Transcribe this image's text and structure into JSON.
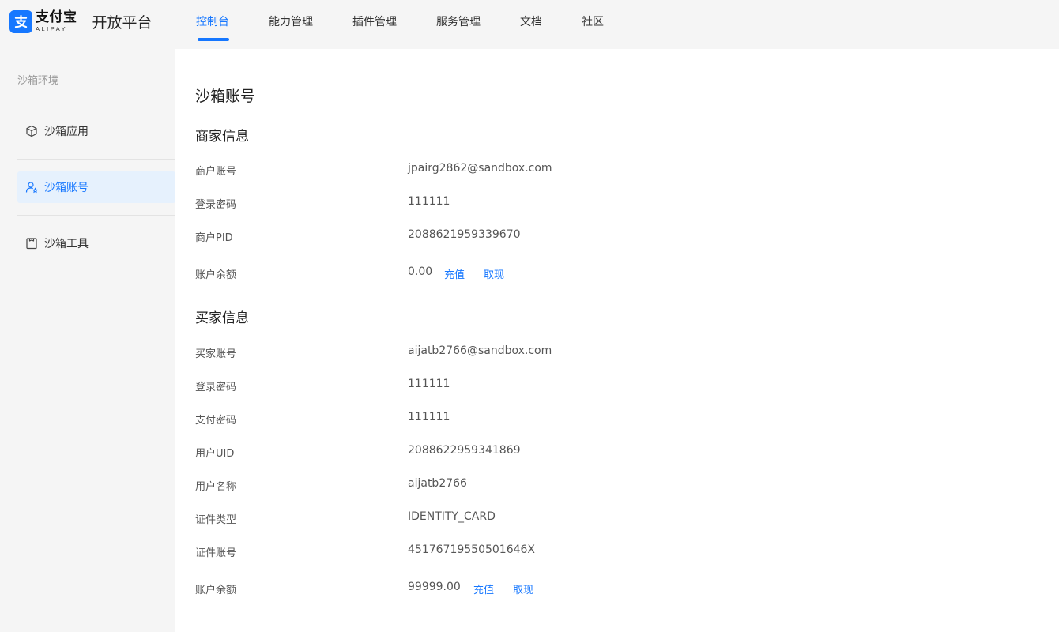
{
  "brand": {
    "cn": "支付宝",
    "en": "ALIPAY",
    "platform": "开放平台",
    "color": "#1677ff"
  },
  "nav": {
    "items": [
      "控制台",
      "能力管理",
      "插件管理",
      "服务管理",
      "文档",
      "社区"
    ],
    "active_index": 0
  },
  "sidebar": {
    "title": "沙箱环境",
    "items": [
      {
        "label": "沙箱应用",
        "icon": "cube-icon"
      },
      {
        "label": "沙箱账号",
        "icon": "user-star-icon"
      },
      {
        "label": "沙箱工具",
        "icon": "clipboard-icon"
      }
    ],
    "active_index": 1
  },
  "page": {
    "title": "沙箱账号"
  },
  "merchant": {
    "title": "商家信息",
    "account_label": "商户账号",
    "account": "jpairg2862@sandbox.com",
    "password_label": "登录密码",
    "password": "111111",
    "pid_label": "商户PID",
    "pid": "2088621959339670",
    "balance_label": "账户余额",
    "balance": "0.00",
    "recharge": "充值",
    "withdraw": "取现"
  },
  "buyer": {
    "title": "买家信息",
    "account_label": "买家账号",
    "account": "aijatb2766@sandbox.com",
    "password_label": "登录密码",
    "password": "111111",
    "pay_password_label": "支付密码",
    "pay_password": "111111",
    "uid_label": "用户UID",
    "uid": "2088622959341869",
    "name_label": "用户名称",
    "name": "aijatb2766",
    "id_type_label": "证件类型",
    "id_type": "IDENTITY_CARD",
    "id_number_label": "证件账号",
    "id_number": "45176719550501646X",
    "balance_label": "账户余额",
    "balance": "99999.00",
    "recharge": "充值",
    "withdraw": "取现"
  }
}
